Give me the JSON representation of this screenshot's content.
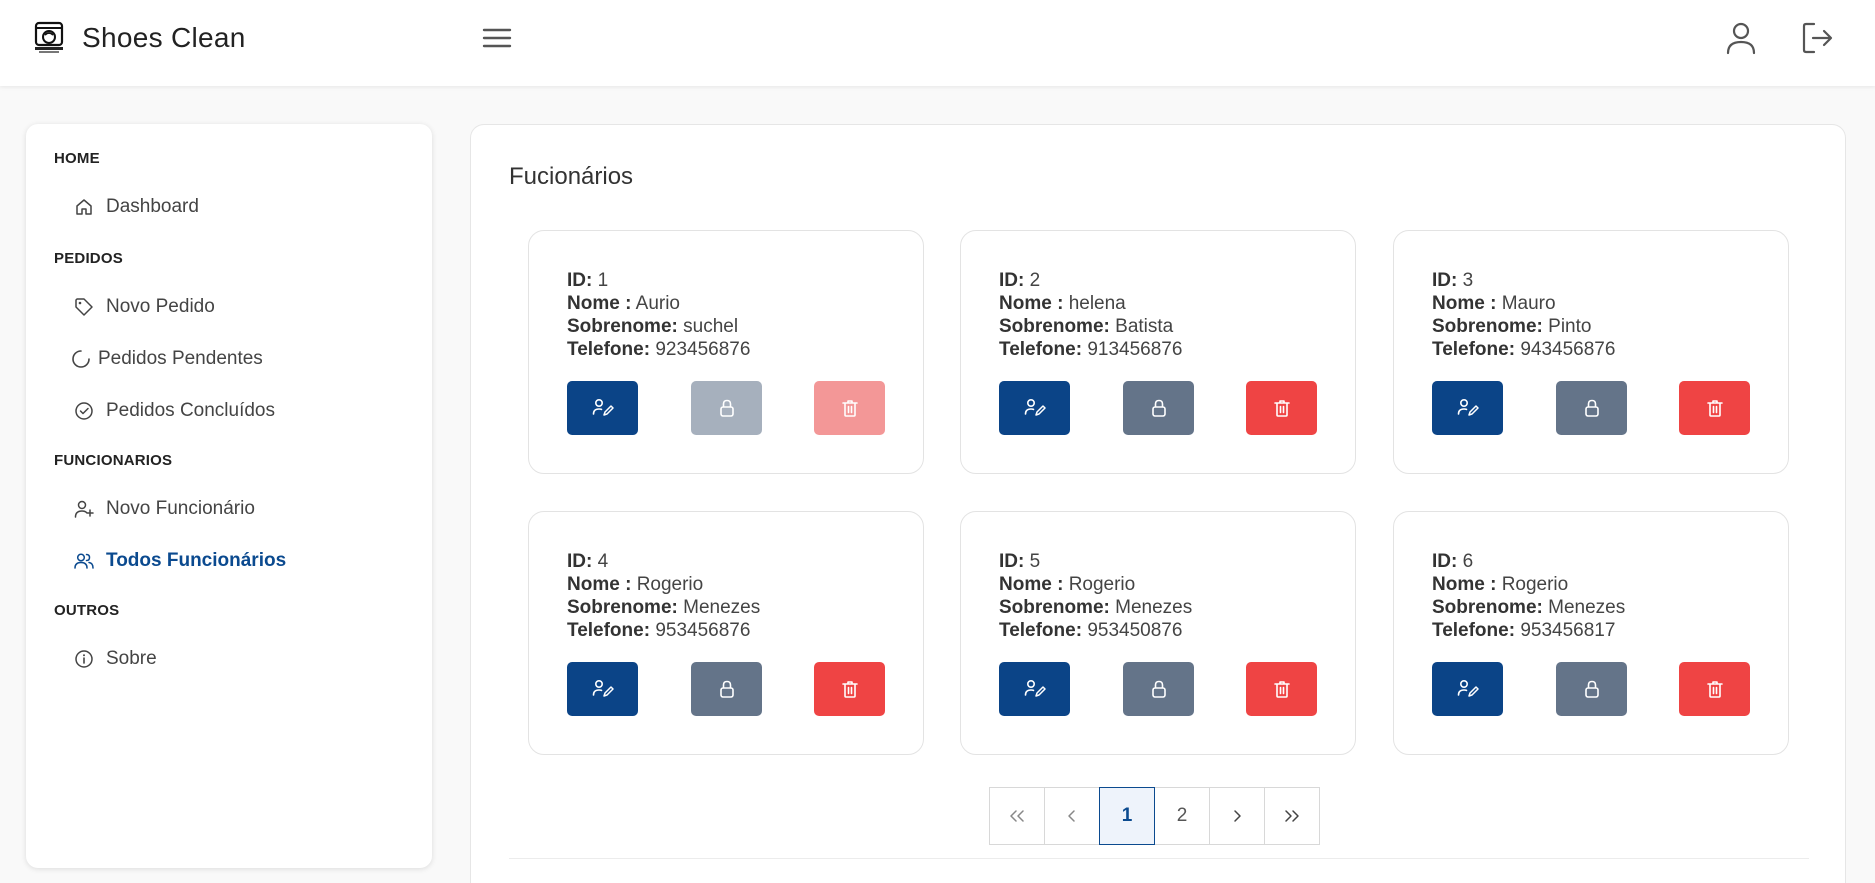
{
  "app": {
    "title": "Shoes Clean"
  },
  "sidebar": {
    "sections": [
      {
        "title": "HOME",
        "items": [
          {
            "label": "Dashboard",
            "icon": "home-icon"
          }
        ]
      },
      {
        "title": "PEDIDOS",
        "items": [
          {
            "label": "Novo Pedido",
            "icon": "tag-icon"
          },
          {
            "label": "Pedidos Pendentes",
            "icon": "loader-icon"
          },
          {
            "label": "Pedidos Concluídos",
            "icon": "check-circle-icon"
          }
        ]
      },
      {
        "title": "FUNCIONARIOS",
        "items": [
          {
            "label": "Novo Funcionário",
            "icon": "user-plus-icon"
          },
          {
            "label": "Todos Funcionários",
            "icon": "users-icon",
            "active": true
          }
        ]
      },
      {
        "title": "OUTROS",
        "items": [
          {
            "label": "Sobre",
            "icon": "info-icon"
          }
        ]
      }
    ]
  },
  "main": {
    "title": "Fucionários",
    "field_labels": {
      "id": "ID:",
      "nome": "Nome :",
      "sobrenome": "Sobrenome:",
      "telefone": "Telefone:"
    },
    "employees": [
      {
        "id": "1",
        "nome": "Aurio",
        "sobrenome": "suchel",
        "telefone": "923456876",
        "disabled": true
      },
      {
        "id": "2",
        "nome": "helena",
        "sobrenome": "Batista",
        "telefone": "913456876",
        "disabled": false
      },
      {
        "id": "3",
        "nome": "Mauro",
        "sobrenome": "Pinto",
        "telefone": "943456876",
        "disabled": false
      },
      {
        "id": "4",
        "nome": "Rogerio",
        "sobrenome": "Menezes",
        "telefone": "953456876",
        "disabled": false
      },
      {
        "id": "5",
        "nome": "Rogerio",
        "sobrenome": "Menezes",
        "telefone": "953450876",
        "disabled": false
      },
      {
        "id": "6",
        "nome": "Rogerio",
        "sobrenome": "Menezes",
        "telefone": "953456817",
        "disabled": false
      }
    ],
    "pagination": {
      "first": "«",
      "prev": "‹",
      "pages": [
        "1",
        "2"
      ],
      "current": "1",
      "next": "›",
      "last": "»"
    }
  },
  "colors": {
    "primary": "#0b4487",
    "lock": "#647489",
    "danger": "#ef4444",
    "active_nav": "#0b4a8f"
  }
}
